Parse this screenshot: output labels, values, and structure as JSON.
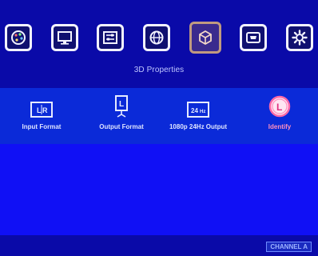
{
  "header": {
    "icons": [
      {
        "name": "color-palette-icon",
        "selected": false
      },
      {
        "name": "monitor-icon",
        "selected": false
      },
      {
        "name": "sliders-icon",
        "selected": false
      },
      {
        "name": "globe-icon",
        "selected": false
      },
      {
        "name": "3d-cube-icon",
        "selected": true
      },
      {
        "name": "hdmi-port-icon",
        "selected": false
      },
      {
        "name": "gear-icon",
        "selected": false
      }
    ],
    "section_title": "3D Properties"
  },
  "submenu": {
    "items": [
      {
        "label": "Input Format",
        "icon": "lr-icon",
        "active": false
      },
      {
        "label": "Output Format",
        "icon": "l-screen-icon",
        "active": false
      },
      {
        "label": "1080p 24Hz Output",
        "icon": "24hz-icon",
        "active": false
      },
      {
        "label": "Identify",
        "icon": "l-circle-icon",
        "active": true
      }
    ]
  },
  "footer": {
    "channel_label": "CHANNEL A"
  },
  "colors": {
    "background": "#1010f5",
    "topbar": "#0a0aa8",
    "selected_border": "#c09a80",
    "active_item": "#ff8fbf"
  }
}
